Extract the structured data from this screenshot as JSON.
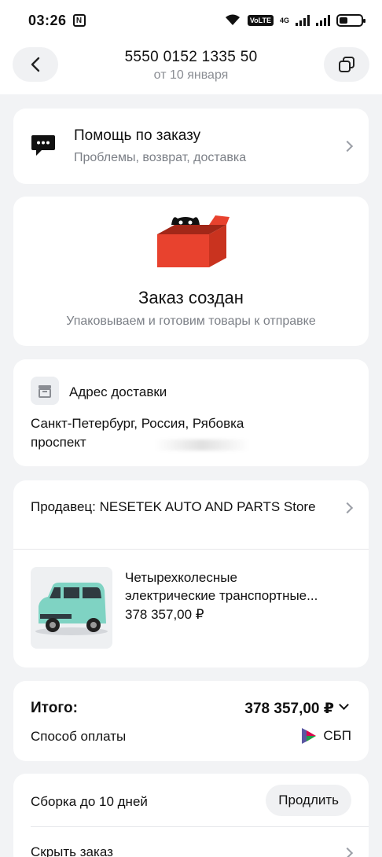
{
  "status_bar": {
    "time": "03:26",
    "nfc": "N",
    "wifi": "6",
    "volte": "VoLTE",
    "network": "4G",
    "sims": [
      "1",
      "2"
    ]
  },
  "header": {
    "order_number": "5550 0152 1335 50",
    "date": "от 10 января"
  },
  "help": {
    "title": "Помощь по заказу",
    "subtitle": "Проблемы, возврат, доставка"
  },
  "order_status": {
    "title": "Заказ создан",
    "subtitle": "Упаковываем и готовим товары к отправке",
    "box_color": "#e8422e"
  },
  "address": {
    "title": "Адрес доставки",
    "line1": "Санкт-Петербург, Россия, Рябовка",
    "line2": "проспект"
  },
  "seller": {
    "label": "Продавец: NESETEK AUTO AND PARTS Store"
  },
  "product": {
    "name_line1": "Четырехколесные",
    "name_line2": "электрические транспортные...",
    "price": "378 357,00 ₽",
    "car_color": "#7fd3c3"
  },
  "totals": {
    "label": "Итого:",
    "amount": "378 357,00 ₽",
    "payment_label": "Способ оплаты",
    "payment_method": "СБП"
  },
  "bottom": {
    "assembly": "Сборка до 10 дней",
    "extend_button": "Продлить",
    "hide_order": "Скрыть заказ"
  }
}
